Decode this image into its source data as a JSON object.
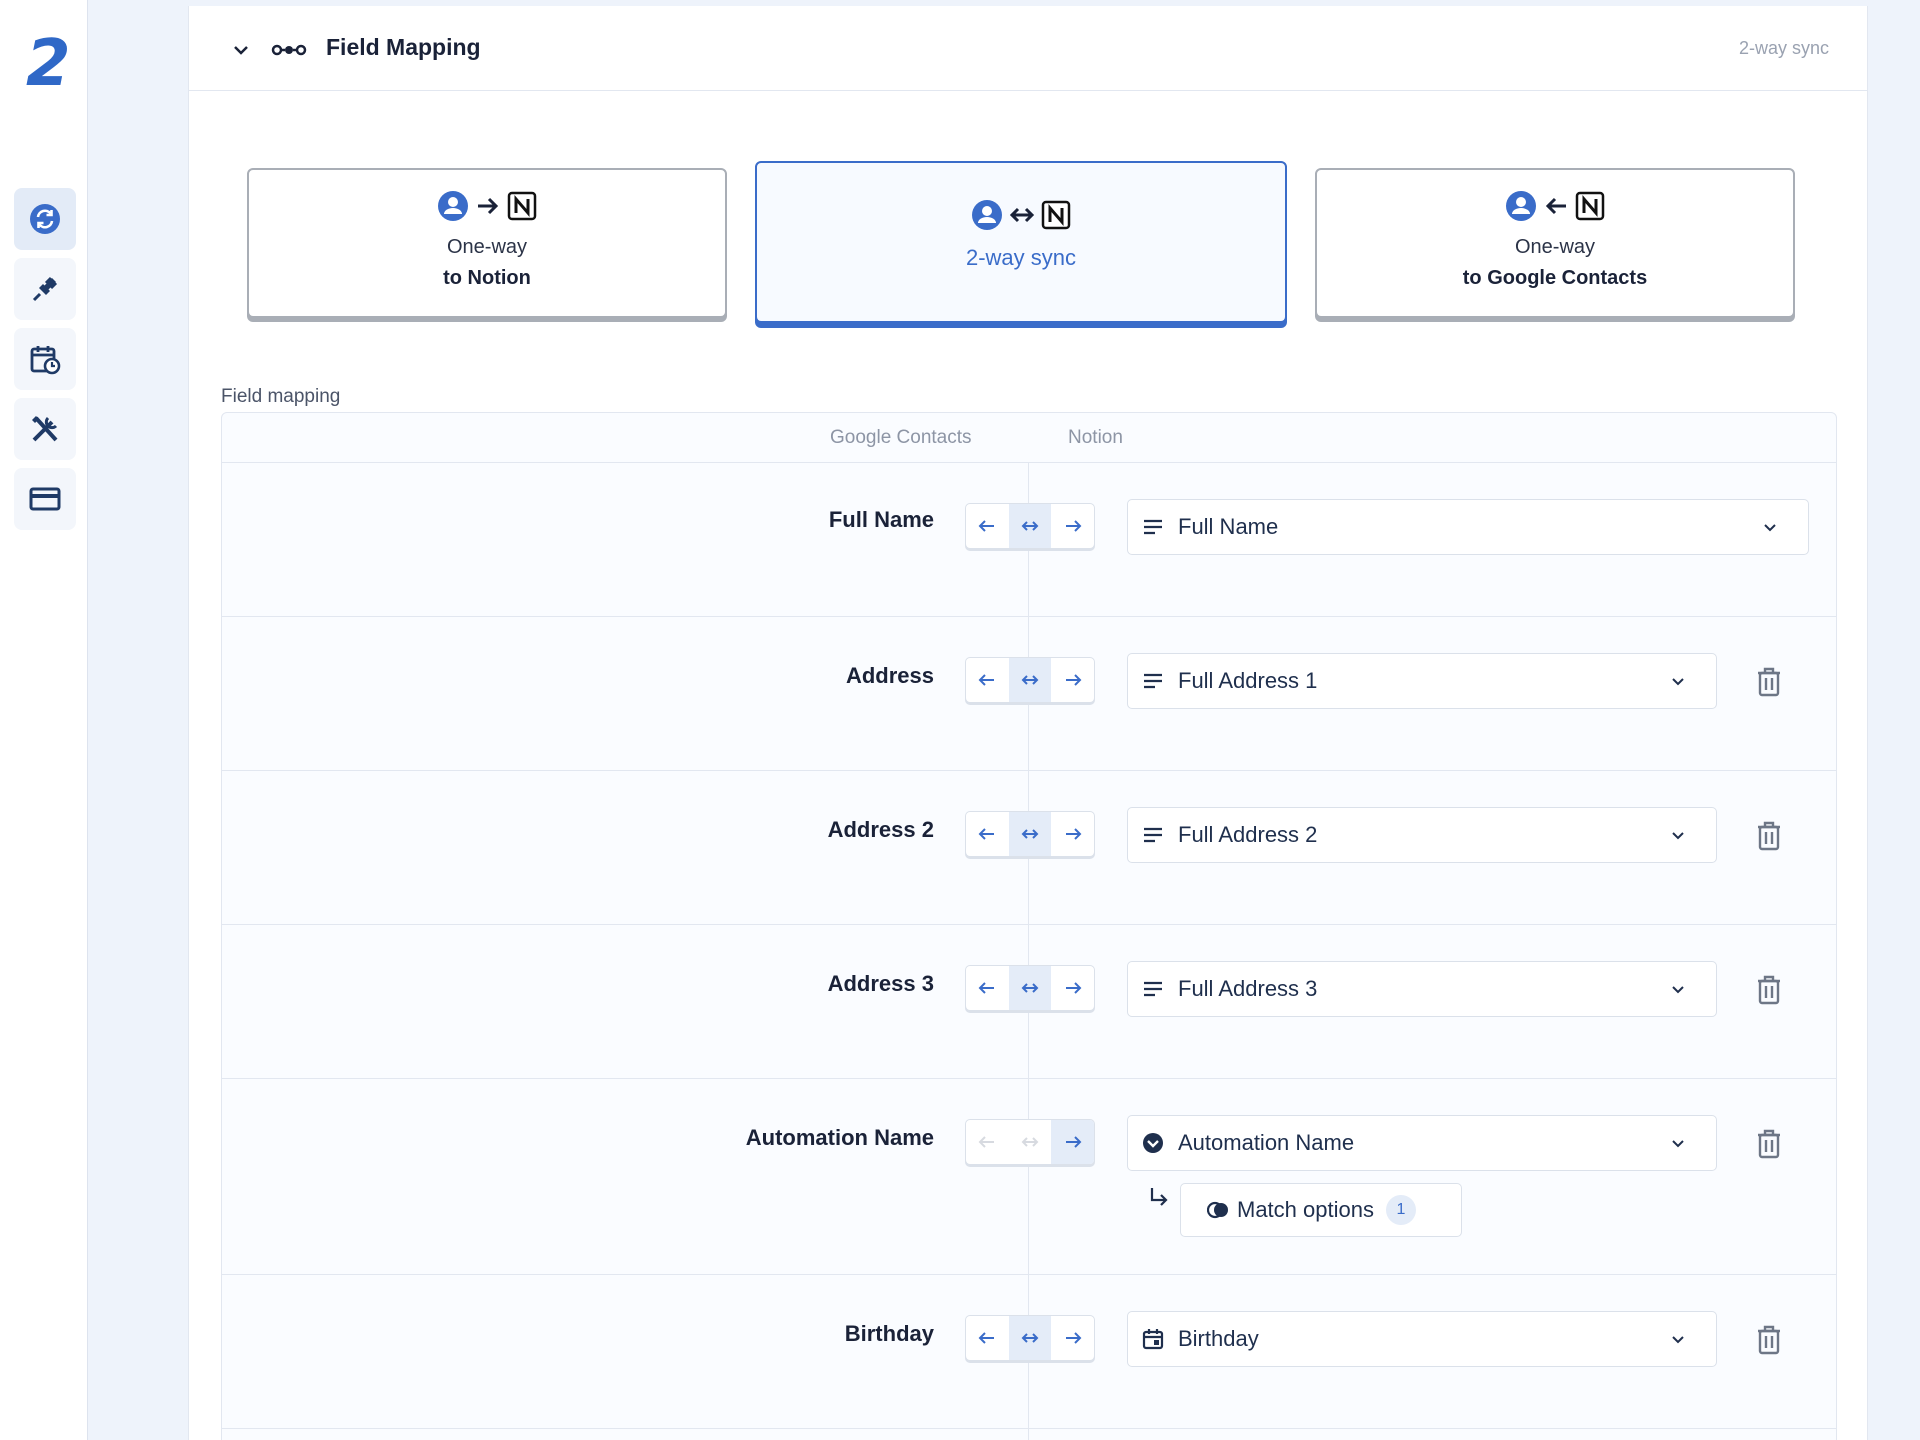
{
  "sidebar": {
    "logo": "2",
    "items": [
      {
        "icon": "sync-icon",
        "active": true
      },
      {
        "icon": "plug-icon",
        "active": false
      },
      {
        "icon": "calendar-clock-icon",
        "active": false
      },
      {
        "icon": "tools-icon",
        "active": false
      },
      {
        "icon": "credit-card-icon",
        "active": false
      }
    ]
  },
  "header": {
    "title": "Field Mapping",
    "mode_label": "2-way sync"
  },
  "direction_cards": [
    {
      "line1": "One-way",
      "line2": "to Notion",
      "arrow": "right",
      "selected": false
    },
    {
      "line1": "",
      "line2": "2-way sync",
      "arrow": "both",
      "selected": true
    },
    {
      "line1": "One-way",
      "line2": "to Google Contacts",
      "arrow": "left",
      "selected": false
    }
  ],
  "mapping": {
    "label": "Field mapping",
    "columns": {
      "left": "Google Contacts",
      "right": "Notion"
    },
    "rows": [
      {
        "field": "Full Name",
        "direction": "both",
        "target": "Full Name",
        "target_type": "text-icon",
        "deletable": false
      },
      {
        "field": "Address",
        "direction": "both",
        "target": "Full Address 1",
        "target_type": "text-icon",
        "deletable": true
      },
      {
        "field": "Address 2",
        "direction": "both",
        "target": "Full Address 2",
        "target_type": "text-icon",
        "deletable": true
      },
      {
        "field": "Address 3",
        "direction": "both",
        "target": "Full Address 3",
        "target_type": "text-icon",
        "deletable": true
      },
      {
        "field": "Automation Name",
        "direction": "right",
        "target": "Automation Name",
        "target_type": "select-icon",
        "deletable": true,
        "match_options": {
          "label": "Match options",
          "count": "1"
        }
      },
      {
        "field": "Birthday",
        "direction": "both",
        "target": "Birthday",
        "target_type": "date-icon",
        "deletable": true
      }
    ]
  },
  "colors": {
    "accent": "#3a6cc9",
    "logo": "#2f68c7",
    "text": "#1a2238",
    "muted": "#9aa2b1"
  }
}
